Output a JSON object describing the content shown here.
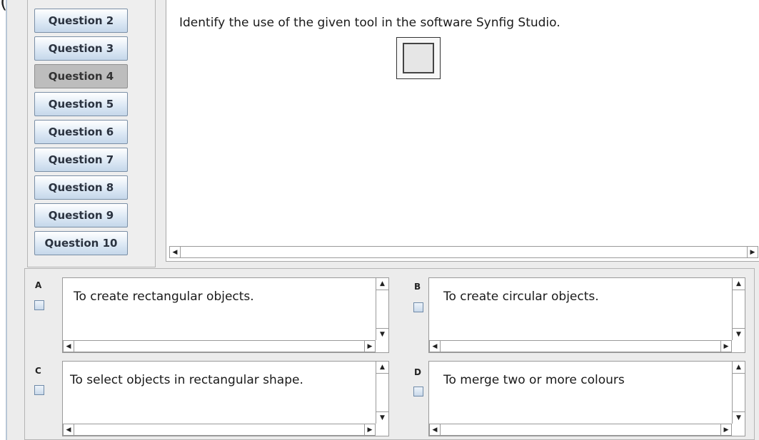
{
  "top_glyph": "(…)",
  "navigation": {
    "questions": [
      {
        "label": "Question 2"
      },
      {
        "label": "Question 3"
      },
      {
        "label": "Question 4"
      },
      {
        "label": "Question 5"
      },
      {
        "label": "Question 6"
      },
      {
        "label": "Question 7"
      },
      {
        "label": "Question 8"
      },
      {
        "label": "Question 9"
      },
      {
        "label": "Question 10"
      }
    ],
    "selected": "Question 4"
  },
  "question": {
    "text": "Identify the use of the given tool in the software Synfig Studio.",
    "image_icon": "rectangle-tool-icon"
  },
  "options": [
    {
      "letter": "A",
      "text": "To create rectangular objects.",
      "checked": false
    },
    {
      "letter": "B",
      "text": "To create circular objects.",
      "checked": false
    },
    {
      "letter": "C",
      "text": "To select objects in rectangular shape.",
      "checked": false
    },
    {
      "letter": "D",
      "text": "To merge two or more colours",
      "checked": false
    }
  ],
  "scroll_arrows": {
    "left": "◀",
    "right": "▶",
    "up": "▲",
    "down": "▼"
  },
  "colors": {
    "button_border": "#7a8fa6",
    "button_selected": "#bdbdbd",
    "checkbox_border": "#6f8aa8"
  }
}
